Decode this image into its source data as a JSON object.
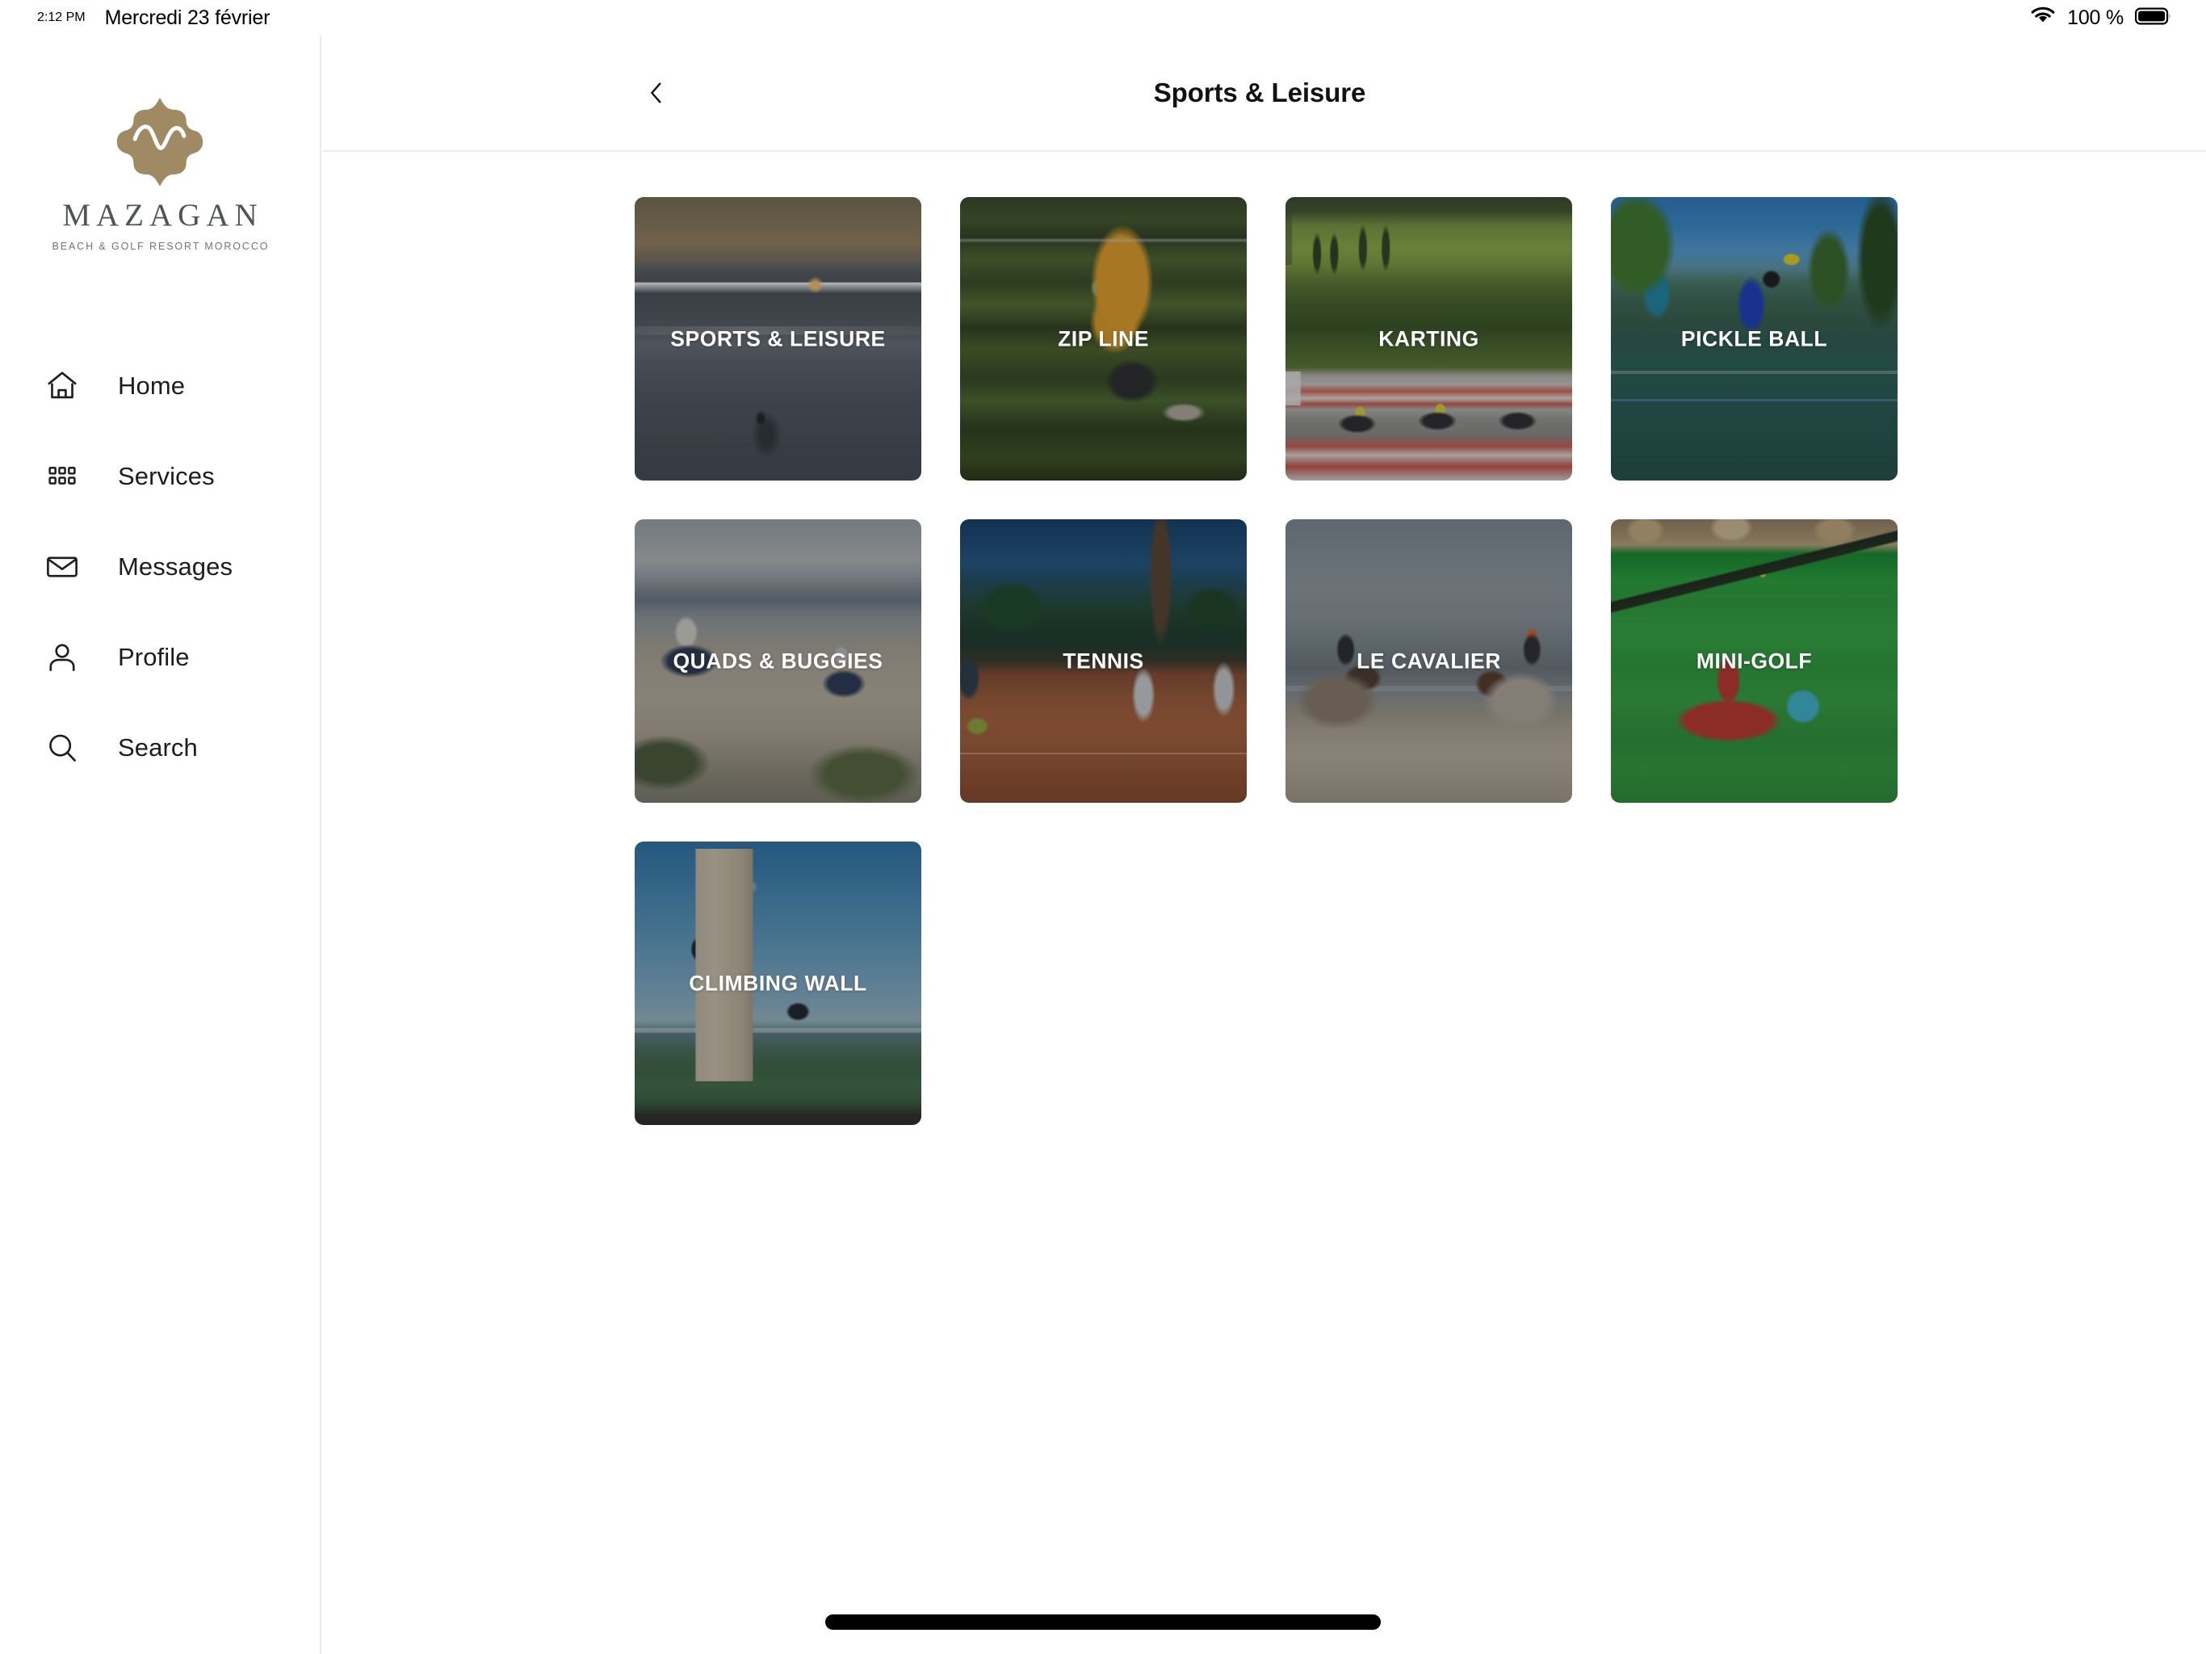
{
  "status_bar": {
    "time": "2:12 PM",
    "date": "Mercredi 23 février",
    "battery_percent": "100 %",
    "wifi_icon": "wifi-icon",
    "battery_icon": "battery-full-icon"
  },
  "sidebar": {
    "brand": {
      "logo_icon": "mazagan-quatrefoil-logo",
      "name": "MAZAGAN",
      "tagline": "BEACH & GOLF RESORT MOROCCO",
      "logo_color": "#a08a63"
    },
    "items": [
      {
        "label": "Home",
        "icon": "home-icon"
      },
      {
        "label": "Services",
        "icon": "grid-icon"
      },
      {
        "label": "Messages",
        "icon": "envelope-icon"
      },
      {
        "label": "Profile",
        "icon": "person-icon"
      },
      {
        "label": "Search",
        "icon": "search-icon"
      }
    ]
  },
  "header": {
    "back_icon": "chevron-left-icon",
    "title": "Sports & Leisure"
  },
  "grid": {
    "cards": [
      {
        "label": "SPORTS & LEISURE",
        "bg": "bg-sunset-ocean"
      },
      {
        "label": "ZIP LINE",
        "bg": "bg-zipline"
      },
      {
        "label": "KARTING",
        "bg": "bg-karting"
      },
      {
        "label": "PICKLE BALL",
        "bg": "bg-pickleball"
      },
      {
        "label": "QUADS & BUGGIES",
        "bg": "bg-quads"
      },
      {
        "label": "TENNIS",
        "bg": "bg-tennis"
      },
      {
        "label": "LE CAVALIER",
        "bg": "bg-cavalier"
      },
      {
        "label": "MINI-GOLF",
        "bg": "bg-minigolf"
      },
      {
        "label": "CLIMBING WALL",
        "bg": "bg-climbing"
      }
    ]
  },
  "home_indicator": "home-indicator-bar"
}
